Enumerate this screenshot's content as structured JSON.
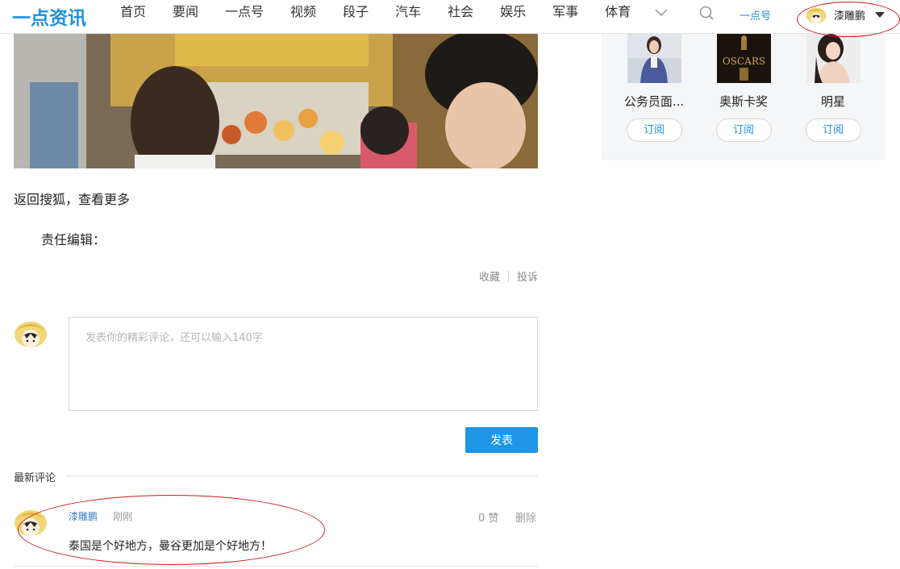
{
  "header": {
    "logo": "一点资讯",
    "nav": [
      "首页",
      "要闻",
      "一点号",
      "视频",
      "段子",
      "汽车",
      "社会",
      "娱乐",
      "军事",
      "体育"
    ],
    "more_icon": "chevron-down-icon",
    "search_icon": "search-icon",
    "yidian_link": "一点号",
    "username": "漆雕鹏"
  },
  "article": {
    "image_icon": "photo",
    "back_link": "返回搜狐，查看更多",
    "editor_label": "责任编辑：",
    "actions": {
      "collect": "收藏",
      "report": "投诉"
    }
  },
  "comment_form": {
    "placeholder": "发表你的精彩评论，还可以输入140字",
    "submit": "发表"
  },
  "latest": {
    "title": "最新评论",
    "comments": [
      {
        "user": "漆雕鹏",
        "time": "刚刚",
        "likes": "0 赞",
        "delete": "删除",
        "text": "泰国是个好地方，曼谷更加是个好地方！"
      }
    ]
  },
  "sidebar": {
    "items": [
      {
        "name": "公务员面...",
        "button": "订阅"
      },
      {
        "name": "奥斯卡奖",
        "button": "订阅"
      },
      {
        "name": "明星",
        "button": "订阅"
      }
    ]
  },
  "colors": {
    "brand": "#1e90e0",
    "button": "#1e95e6",
    "annotation": "#d01818"
  }
}
